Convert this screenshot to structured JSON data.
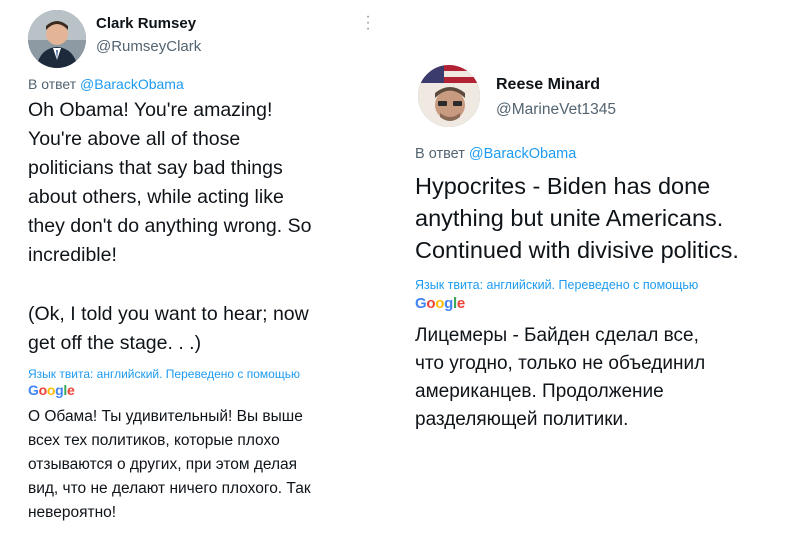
{
  "tweets": [
    {
      "author": "Clark Rumsey",
      "handle": "@RumseyClark",
      "reply_prefix": "В ответ",
      "reply_to": "@BarackObama",
      "text": "Oh Obama! You're amazing!\nYou're above all of those\npoliticians that say bad things\nabout others, while acting like\nthey don't do anything wrong. So\nincredible!",
      "text_2": "(Ok, I told you want to hear; now\nget off the stage. . .)",
      "translation_note": "Язык твита: английский. Переведено с помощью",
      "translation_provider": "Google",
      "translation": "О Обама! Ты удивительный! Вы выше\nвсех тех политиков, которые плохо\nотзываются о других, при этом делая\nвид, что не делают ничего плохого. Так\nневероятно!"
    },
    {
      "author": "Reese Minard",
      "handle": "@MarineVet1345",
      "reply_prefix": "В ответ",
      "reply_to": "@BarackObama",
      "text": "Hypocrites - Biden has done\nanything but unite Americans.\nContinued with divisive politics.",
      "translation_note": "Язык твита: английский. Переведено с помощью",
      "translation_provider": "Google",
      "translation": "Лицемеры - Байден сделал все,\nчто угодно, только не объединил\nамериканцев. Продолжение\nразделяющей политики."
    }
  ],
  "icons": {
    "more": "more-vertical-icon"
  },
  "colors": {
    "link": "#1d9bf0",
    "secondary": "#536471",
    "text": "#0f1419"
  }
}
